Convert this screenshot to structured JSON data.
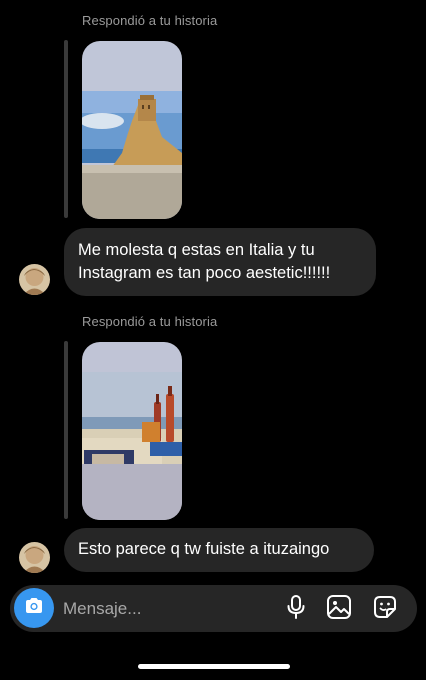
{
  "thread": {
    "messages": [
      {
        "reply_label": "Respondió a tu historia",
        "text_lines": [
          "Me molesta q estas en Italia y tu",
          "Instagram es tan poco aestetic!!!!!!"
        ]
      },
      {
        "reply_label": "Respondió a tu historia",
        "text_lines": [
          "Esto parece q tw fuiste a ituzaingo"
        ]
      }
    ]
  },
  "composer": {
    "placeholder": "Mensaje...",
    "icons": [
      "camera-icon",
      "microphone-icon",
      "gallery-icon",
      "sticker-icon"
    ],
    "accent_color": "#3797f0"
  },
  "colors": {
    "background": "#000000",
    "bubble": "#262626",
    "label": "#9a9a9a"
  }
}
